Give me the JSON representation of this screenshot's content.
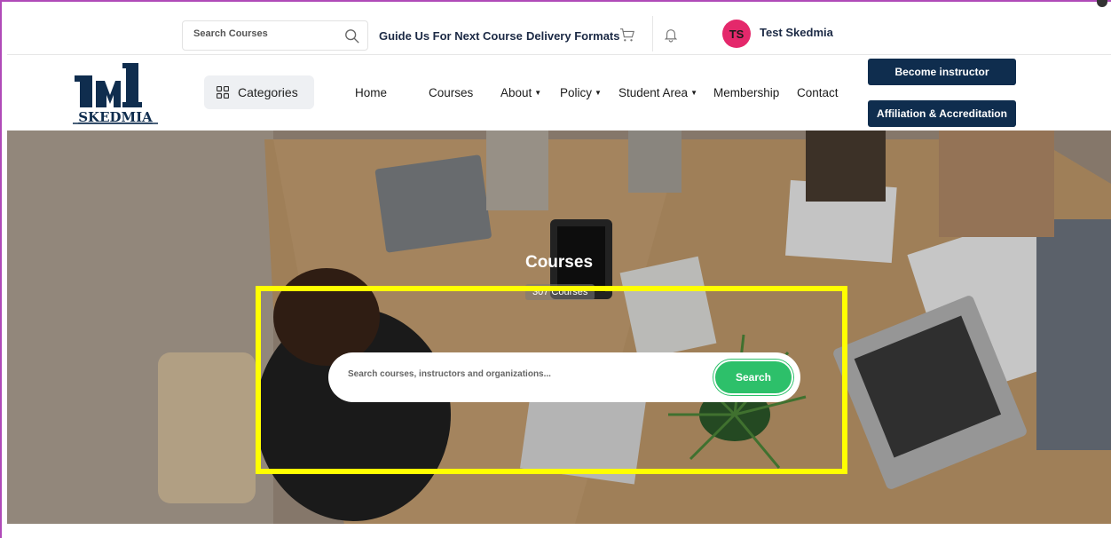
{
  "topbar": {
    "search_placeholder": "Search Courses",
    "guide_link": "Guide Us For Next Course",
    "delivery_link": "Delivery Formats",
    "user": {
      "initials": "TS",
      "name": "Test Skedmia"
    }
  },
  "navbar": {
    "logo_text": "SKEDMIA",
    "categories_label": "Categories",
    "items": [
      {
        "label": "Home"
      },
      {
        "label": "Courses"
      },
      {
        "label": "About"
      },
      {
        "label": "Policy"
      },
      {
        "label": "Student Area"
      },
      {
        "label": "Membership"
      },
      {
        "label": "Contact"
      }
    ],
    "become_instructor": "Become instructor",
    "affiliation": "Affiliation & Accreditation"
  },
  "hero": {
    "title": "Courses",
    "count": "307 Courses",
    "search_placeholder": "Search courses, instructors and organizations...",
    "search_button": "Search"
  },
  "colors": {
    "brand_dark": "#0f2d4e",
    "avatar": "#e4286b",
    "search_button": "#2dc06a",
    "highlight": "#ffff00"
  },
  "icons": {
    "top_search": "search-icon",
    "cart": "cart-icon",
    "bell": "bell-icon",
    "categories": "grid-icon"
  }
}
